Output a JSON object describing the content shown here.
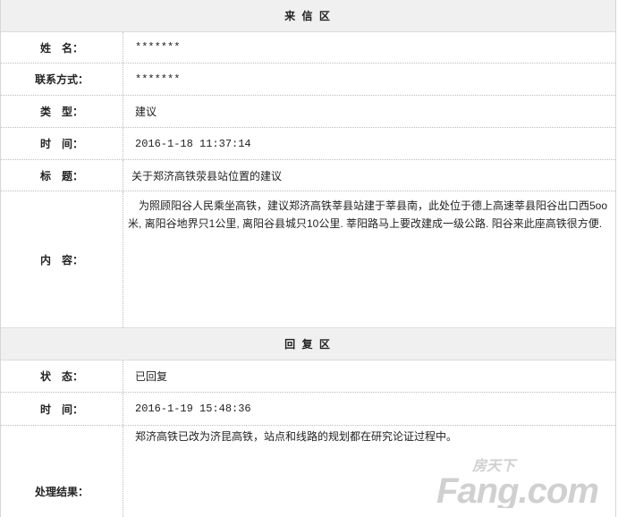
{
  "incoming": {
    "title": "来 信 区",
    "name_label": "姓　名：",
    "name_value": "*******",
    "contact_label": "联系方式：",
    "contact_value": "*******",
    "type_label": "类　型：",
    "type_value": "建议",
    "time_label": "时　间：",
    "time_value": "2016-1-18  11:37:14",
    "subject_label": "标　题：",
    "subject_value": "关于郑济高铁荥县站位置的建议",
    "content_label": "内　容：",
    "content_value": "为照顾阳谷人民乘坐高铁，建议郑济高铁莘县站建于莘县南，此处位于德上高速莘县阳谷出口西5oo米, 离阳谷地界只1公里, 离阳谷县城只10公里. 莘阳路马上要改建成一级公路. 阳谷来此座高铁很方便."
  },
  "reply": {
    "title": "回 复 区",
    "status_label": "状　态：",
    "status_value": "已回复",
    "time_label": "时　间：",
    "time_value": "2016-1-19  15:48:36",
    "result_label": "处理结果：",
    "result_value": "郑济高铁已改为济昆高铁，站点和线路的规划都在研究论证过程中。"
  },
  "watermark": {
    "brand_top": "房天下",
    "brand_main": "Fang.com"
  },
  "colors": {
    "header_bg": "#f0f0f0",
    "watermark": "#c8c8c8"
  }
}
